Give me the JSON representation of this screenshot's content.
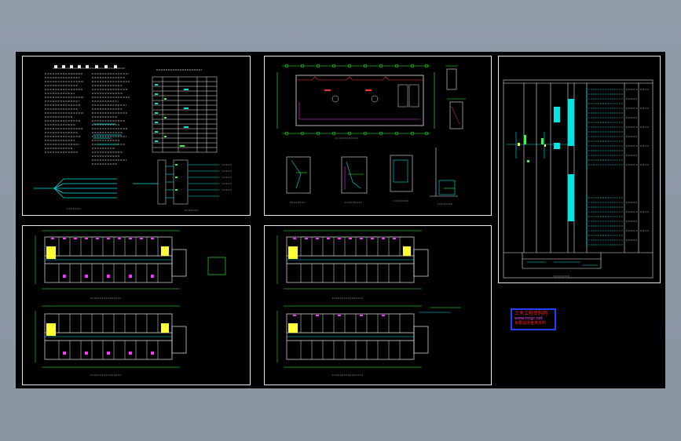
{
  "viewer": {
    "background": "#8e99a6",
    "modelspace_color": "#000000",
    "frame_color": "#e6e6e6"
  },
  "colors": {
    "cyan": "#00e5e5",
    "green": "#33ff33",
    "magenta": "#ff33ff",
    "yellow": "#ffff33",
    "red": "#ff3333",
    "white": "#e6e6e6",
    "blue": "#2040ff"
  },
  "sheets": [
    {
      "id": "design-notes",
      "content": "electrical design notes, legend table, distribution diagram"
    },
    {
      "id": "substation-plan",
      "content": "substation plan and sections"
    },
    {
      "id": "system-diagram",
      "content": "power distribution system diagram"
    },
    {
      "id": "floor-plan-lower",
      "content": "dormitory lighting plans"
    },
    {
      "id": "floor-plan-upper",
      "content": "dormitory power plans"
    }
  ],
  "stamp": {
    "line1": "土木工程资料网",
    "line2": "www.tmgc.net",
    "line3": "免费提供各类资料"
  }
}
